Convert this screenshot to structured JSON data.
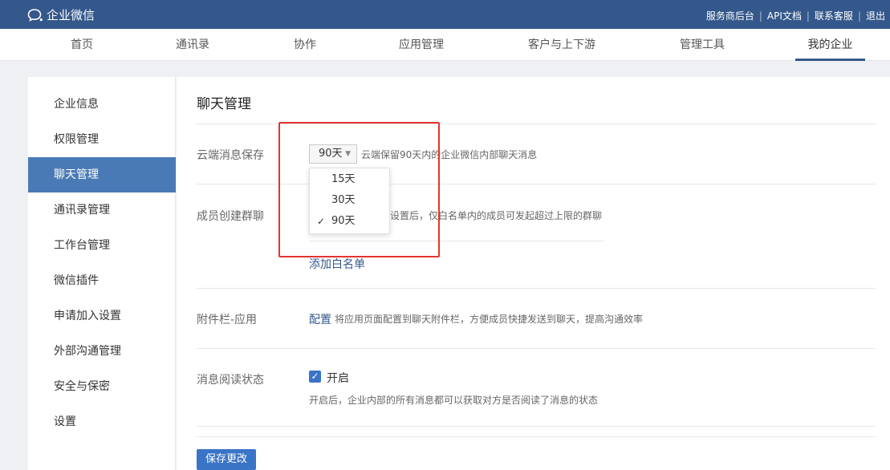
{
  "topbar": {
    "logo_text": "企业微信",
    "links": [
      "服务商后台",
      "API文档",
      "联系客服",
      "退出"
    ],
    "bg_color": "#34588b"
  },
  "nav": {
    "tabs": [
      "首页",
      "通讯录",
      "协作",
      "应用管理",
      "客户与上下游",
      "管理工具",
      "我的企业"
    ],
    "active": "我的企业"
  },
  "sidebar": {
    "items": [
      "企业信息",
      "权限管理",
      "聊天管理",
      "通讯录管理",
      "工作台管理",
      "微信插件",
      "申请加入设置",
      "外部沟通管理",
      "安全与保密",
      "设置"
    ],
    "active": "聊天管理"
  },
  "main": {
    "title": "聊天管理",
    "cloud_storage": {
      "label": "云端消息保存",
      "selected": "90天",
      "hint": "云端保留90天内的企业微信内部聊天消息",
      "options": [
        "15天",
        "30天",
        "90天"
      ],
      "checked_option": "90天"
    },
    "group_create": {
      "label": "成员创建群聊",
      "hint": "设置后，仅白名单内的成员可发起超过上限的群聊",
      "add_whitelist": "添加白名单"
    },
    "attachment_bar": {
      "label": "附件栏-应用",
      "config_link": "配置",
      "hint": "将应用页面配置到聊天附件栏，方便成员快捷发送到聊天，提高沟通效率"
    },
    "read_status": {
      "label": "消息阅读状态",
      "checkbox_label": "开启",
      "checked": true,
      "hint": "开启后，企业内部的所有消息都可以获取对方是否阅读了消息的状态"
    },
    "save_button": "保存更改"
  },
  "colors": {
    "accent": "#3a74c6",
    "sidebar_active": "#4a7ab5",
    "highlight_box": "#e3342f"
  }
}
